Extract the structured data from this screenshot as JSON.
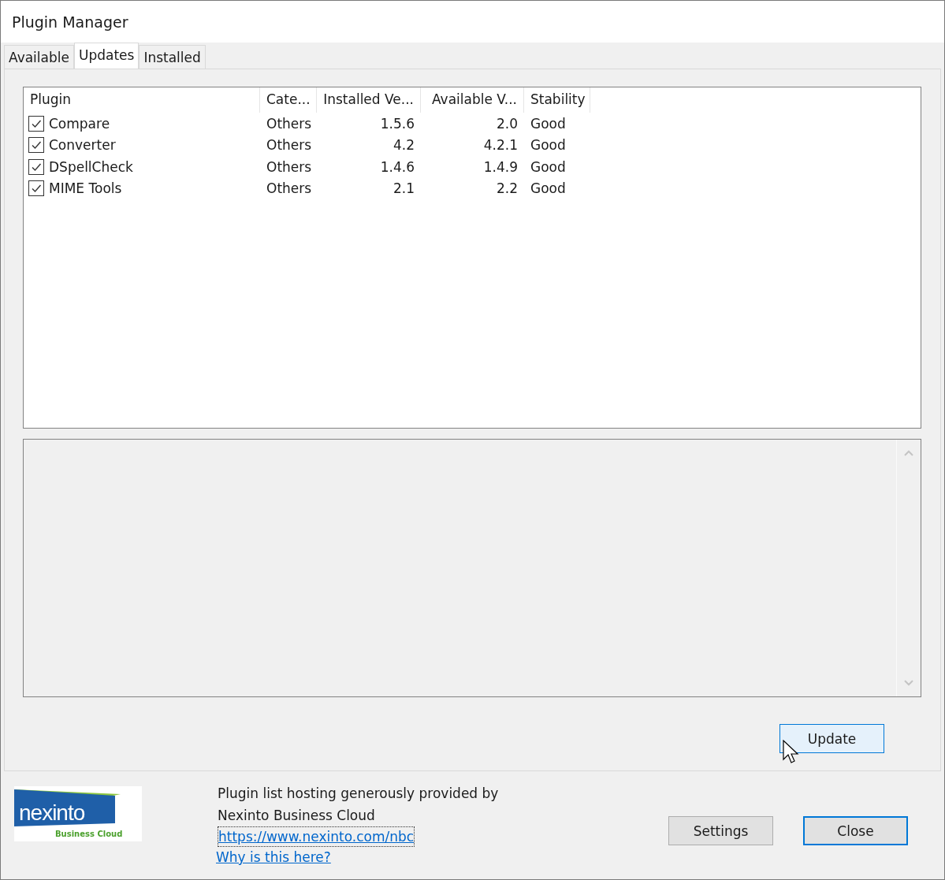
{
  "window": {
    "title": "Plugin Manager"
  },
  "tabs": [
    {
      "label": "Available",
      "selected": false
    },
    {
      "label": "Updates",
      "selected": true
    },
    {
      "label": "Installed",
      "selected": false
    }
  ],
  "table": {
    "columns": [
      "Plugin",
      "Cate...",
      "Installed Ve...",
      "Available V...",
      "Stability"
    ],
    "rows": [
      {
        "checked": true,
        "cells": [
          "Compare",
          "Others",
          "1.5.6",
          "2.0",
          "Good"
        ]
      },
      {
        "checked": true,
        "cells": [
          "Converter",
          "Others",
          "4.2",
          "4.2.1",
          "Good"
        ]
      },
      {
        "checked": true,
        "cells": [
          "DSpellCheck",
          "Others",
          "1.4.6",
          "1.4.9",
          "Good"
        ]
      },
      {
        "checked": true,
        "cells": [
          "MIME Tools",
          "Others",
          "2.1",
          "2.2",
          "Good"
        ]
      }
    ]
  },
  "update_button": {
    "label": "Update",
    "hovered": true
  },
  "footer": {
    "logo": {
      "name": "nexinto",
      "tagline": "Business Cloud"
    },
    "hosting_text": "Plugin list hosting generously provided by",
    "host_name": "Nexinto Business Cloud",
    "links": [
      {
        "label": "https://www.nexinto.com/nbc",
        "focused": true
      },
      {
        "label": "Why is this here?",
        "focused": false
      }
    ],
    "buttons": [
      {
        "label": "Settings",
        "default": false
      },
      {
        "label": "Close",
        "default": true
      }
    ]
  }
}
